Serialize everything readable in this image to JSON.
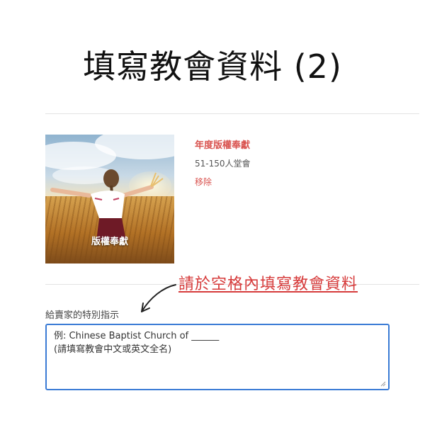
{
  "page": {
    "title": "填寫教會資料 (2)"
  },
  "cart_item": {
    "image_caption": "版權奉獻",
    "name": "年度版權奉獻",
    "variant": "51-150人堂會",
    "remove_label": "移除"
  },
  "annotation": {
    "text": "請於空格內填寫教會資料",
    "color": "#d63a3a"
  },
  "special_instructions": {
    "label": "給賣家的特別指示",
    "lines": [
      "例: Chinese Baptist Church of ______",
      "(請填寫教會中文或英文全名)"
    ]
  },
  "colors": {
    "accent_red": "#d9534f",
    "focus_blue": "#3a7bd5"
  }
}
